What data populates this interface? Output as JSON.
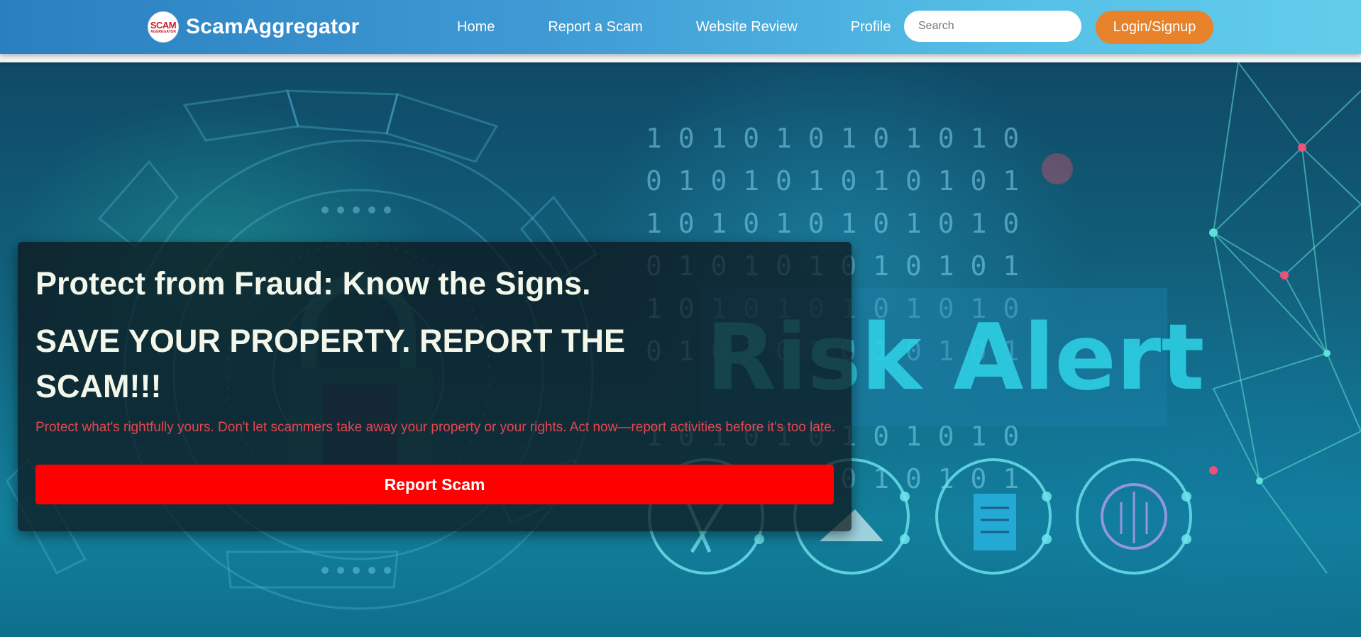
{
  "brand": {
    "logo_text_top": "SCAM",
    "logo_text_bottom": "AGGREGATOR",
    "name": "ScamAggregator"
  },
  "nav": {
    "links": [
      {
        "label": "Home"
      },
      {
        "label": "Report a Scam"
      },
      {
        "label": "Website Review"
      },
      {
        "label": "Profile"
      }
    ],
    "search_placeholder": "Search",
    "login_label": "Login/Signup"
  },
  "hero": {
    "title": "Protect from Fraud: Know the Signs.",
    "headline": "SAVE YOUR PROPERTY. REPORT THE SCAM!!!",
    "subtitle": "Protect what's rightfully yours. Don't let scammers take away your property or your rights. Act now—report activities before it's too late.",
    "cta_label": "Report Scam",
    "background_text": "Risk Alert"
  },
  "colors": {
    "nav_gradient_start": "#2a7fc0",
    "nav_gradient_end": "#62cdeb",
    "login_button": "#e8822a",
    "cta_button": "#ff0000",
    "subtitle_text": "#e8454f",
    "headline_text": "#f2f7ea"
  },
  "icons": [
    "logo-icon",
    "padlock-icon",
    "wrench-icon",
    "image-icon",
    "document-icon",
    "circuit-icon"
  ]
}
